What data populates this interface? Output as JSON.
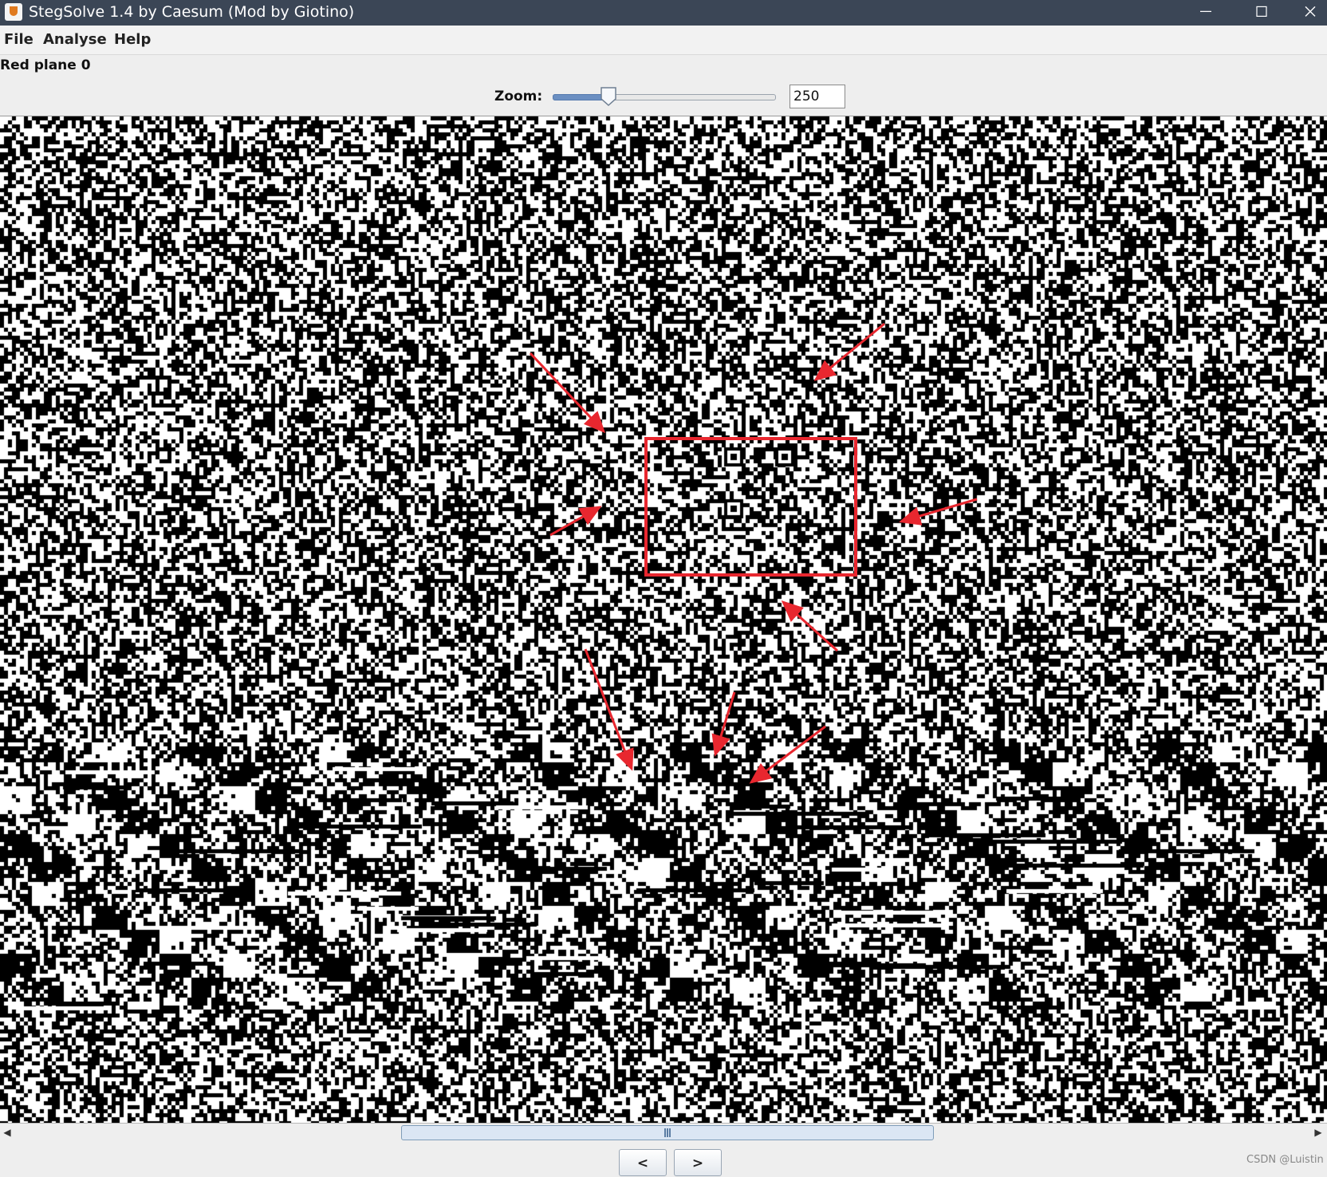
{
  "window": {
    "title": "StegSolve 1.4 by Caesum (Mod by Giotino)",
    "minimize_glyph": "—",
    "close_glyph": "✕"
  },
  "menu": {
    "items": [
      {
        "label": "File"
      },
      {
        "label": "Analyse"
      },
      {
        "label": "Help"
      }
    ]
  },
  "plane": {
    "label": "Red plane 0"
  },
  "zoom": {
    "label": "Zoom:",
    "value": "250",
    "slider_fraction": 0.25
  },
  "navigation": {
    "prev_label": "<",
    "next_label": ">"
  },
  "watermark": "CSDN @Luistin",
  "colors": {
    "titlebar": "#3b4656",
    "annotation_red": "#e8272f",
    "scroll_thumb": "#dbe6f4"
  },
  "icons": {
    "app": "java-coffee-icon",
    "minimize": "minimize-icon",
    "maximize": "maximize-icon",
    "close": "close-icon"
  }
}
